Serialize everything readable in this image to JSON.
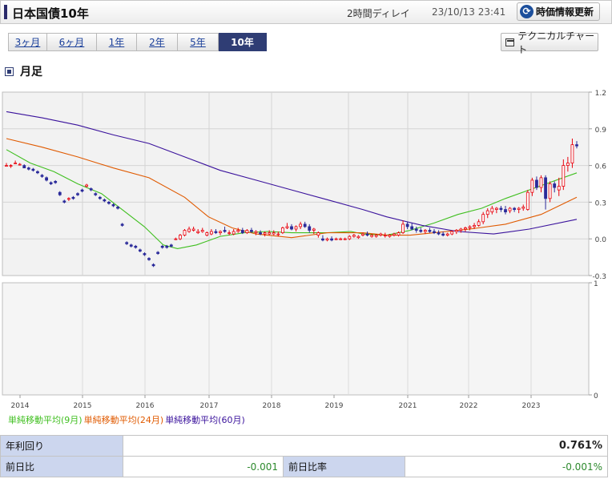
{
  "header": {
    "title": "日本国債10年",
    "delay": "2時間ディレイ",
    "timestamp": "23/10/13 23:41",
    "refresh_label": "時価情報更新",
    "refresh_icon": "refresh-icon"
  },
  "tabs": [
    {
      "label": "3ヶ月",
      "active": false
    },
    {
      "label": "6ヶ月",
      "active": false
    },
    {
      "label": "1年",
      "active": false
    },
    {
      "label": "2年",
      "active": false
    },
    {
      "label": "5年",
      "active": false
    },
    {
      "label": "10年",
      "active": true
    }
  ],
  "technical_button": "テクニカルチャート",
  "section_title": "月足",
  "legend": [
    {
      "label": "単純移動平均(9月)",
      "color": "#3fbf1f"
    },
    {
      "label": "単純移動平均(24月)",
      "color": "#e05a00"
    },
    {
      "label": "単純移動平均(60月)",
      "color": "#3a129c"
    }
  ],
  "quote": {
    "yield_label": "年利回り",
    "yield_value": "0.761%",
    "change_label": "前日比",
    "change_value": "-0.001",
    "change_rate_label": "前日比率",
    "change_rate_value": "-0.001%"
  },
  "chart_data": {
    "type": "candlestick",
    "x_axis": {
      "label": "",
      "ticks": [
        "2014",
        "2015",
        "2016",
        "2017",
        "2018",
        "2019",
        "2021",
        "2022",
        "2023"
      ]
    },
    "price_axis": {
      "ylim": [
        -0.3,
        1.2
      ],
      "ticks": [
        "1.2",
        "0.9",
        "0.6",
        "0.3",
        "0.0",
        "-0.3"
      ]
    },
    "volume_axis": {
      "ticks": [
        "1",
        "0"
      ]
    },
    "colors": {
      "up": "#e8000b",
      "down": "#2a2a9a"
    },
    "candles_approx": [
      [
        0.6,
        0.62,
        0.59,
        0.6
      ],
      [
        0.6,
        0.61,
        0.58,
        0.6
      ],
      [
        0.62,
        0.64,
        0.61,
        0.62
      ],
      [
        0.61,
        0.62,
        0.6,
        0.61
      ],
      [
        0.6,
        0.61,
        0.58,
        0.58
      ],
      [
        0.58,
        0.59,
        0.56,
        0.57
      ],
      [
        0.57,
        0.58,
        0.55,
        0.56
      ],
      [
        0.55,
        0.56,
        0.53,
        0.54
      ],
      [
        0.52,
        0.53,
        0.5,
        0.51
      ],
      [
        0.5,
        0.51,
        0.47,
        0.48
      ],
      [
        0.46,
        0.47,
        0.44,
        0.45
      ],
      [
        0.47,
        0.48,
        0.45,
        0.46
      ],
      [
        0.38,
        0.39,
        0.35,
        0.36
      ],
      [
        0.31,
        0.32,
        0.29,
        0.3
      ],
      [
        0.33,
        0.34,
        0.31,
        0.33
      ],
      [
        0.34,
        0.35,
        0.32,
        0.33
      ],
      [
        0.37,
        0.38,
        0.35,
        0.36
      ],
      [
        0.4,
        0.41,
        0.38,
        0.39
      ],
      [
        0.43,
        0.45,
        0.42,
        0.44
      ],
      [
        0.41,
        0.42,
        0.39,
        0.4
      ],
      [
        0.37,
        0.38,
        0.35,
        0.36
      ],
      [
        0.34,
        0.35,
        0.32,
        0.33
      ],
      [
        0.32,
        0.33,
        0.3,
        0.31
      ],
      [
        0.3,
        0.31,
        0.28,
        0.29
      ],
      [
        0.28,
        0.29,
        0.26,
        0.27
      ],
      [
        0.26,
        0.27,
        0.24,
        0.25
      ],
      [
        0.12,
        0.13,
        0.1,
        0.11
      ],
      [
        -0.03,
        -0.02,
        -0.05,
        -0.04
      ],
      [
        -0.05,
        -0.04,
        -0.07,
        -0.06
      ],
      [
        -0.06,
        -0.05,
        -0.08,
        -0.07
      ],
      [
        -0.09,
        -0.08,
        -0.11,
        -0.1
      ],
      [
        -0.12,
        -0.11,
        -0.14,
        -0.13
      ],
      [
        -0.16,
        -0.15,
        -0.18,
        -0.17
      ],
      [
        -0.21,
        -0.2,
        -0.23,
        -0.22
      ],
      [
        -0.11,
        -0.1,
        -0.13,
        -0.12
      ],
      [
        -0.06,
        -0.05,
        -0.08,
        -0.07
      ],
      [
        -0.06,
        -0.05,
        -0.08,
        -0.07
      ],
      [
        -0.05,
        -0.04,
        -0.07,
        -0.06
      ],
      [
        0.0,
        0.01,
        -0.01,
        0.0
      ],
      [
        0.0,
        0.04,
        -0.01,
        0.03
      ],
      [
        0.03,
        0.08,
        0.02,
        0.07
      ],
      [
        0.06,
        0.1,
        0.05,
        0.08
      ],
      [
        0.07,
        0.1,
        0.06,
        0.08
      ],
      [
        0.05,
        0.08,
        0.04,
        0.06
      ],
      [
        0.06,
        0.09,
        0.05,
        0.07
      ],
      [
        0.03,
        0.06,
        0.02,
        0.05
      ],
      [
        0.04,
        0.08,
        0.03,
        0.06
      ],
      [
        0.06,
        0.08,
        0.04,
        0.05
      ],
      [
        0.05,
        0.07,
        0.03,
        0.06
      ],
      [
        0.07,
        0.1,
        0.05,
        0.06
      ],
      [
        0.05,
        0.07,
        0.03,
        0.05
      ],
      [
        0.04,
        0.08,
        0.03,
        0.06
      ],
      [
        0.06,
        0.09,
        0.05,
        0.07
      ],
      [
        0.07,
        0.09,
        0.04,
        0.05
      ],
      [
        0.05,
        0.08,
        0.04,
        0.07
      ],
      [
        0.07,
        0.09,
        0.05,
        0.06
      ],
      [
        0.05,
        0.07,
        0.03,
        0.06
      ],
      [
        0.05,
        0.07,
        0.03,
        0.04
      ],
      [
        0.04,
        0.06,
        0.02,
        0.05
      ],
      [
        0.04,
        0.07,
        0.03,
        0.05
      ],
      [
        0.04,
        0.07,
        0.03,
        0.05
      ],
      [
        0.04,
        0.06,
        0.02,
        0.04
      ],
      [
        0.05,
        0.1,
        0.04,
        0.09
      ],
      [
        0.09,
        0.13,
        0.08,
        0.1
      ],
      [
        0.1,
        0.12,
        0.07,
        0.08
      ],
      [
        0.08,
        0.11,
        0.06,
        0.1
      ],
      [
        0.1,
        0.14,
        0.08,
        0.12
      ],
      [
        0.12,
        0.14,
        0.09,
        0.1
      ],
      [
        0.1,
        0.12,
        0.05,
        0.07
      ],
      [
        0.07,
        0.09,
        0.04,
        0.08
      ],
      [
        0.03,
        0.06,
        0.01,
        0.05
      ],
      [
        0.0,
        0.03,
        -0.02,
        -0.01
      ],
      [
        -0.01,
        0.01,
        -0.02,
        0.0
      ],
      [
        0.0,
        0.02,
        -0.02,
        -0.01
      ],
      [
        0.0,
        0.01,
        -0.01,
        0.0
      ],
      [
        0.0,
        0.01,
        -0.01,
        0.0
      ],
      [
        0.0,
        0.01,
        -0.01,
        0.0
      ],
      [
        0.0,
        0.03,
        -0.01,
        0.02
      ],
      [
        0.02,
        0.04,
        0.01,
        0.03
      ],
      [
        0.01,
        0.03,
        0.0,
        0.02
      ],
      [
        0.03,
        0.05,
        0.02,
        0.04
      ],
      [
        0.04,
        0.06,
        0.02,
        0.03
      ],
      [
        0.02,
        0.04,
        0.01,
        0.03
      ],
      [
        0.02,
        0.04,
        0.01,
        0.03
      ],
      [
        0.03,
        0.05,
        0.02,
        0.04
      ],
      [
        0.03,
        0.05,
        0.01,
        0.03
      ],
      [
        0.02,
        0.04,
        0.01,
        0.03
      ],
      [
        0.03,
        0.05,
        0.02,
        0.04
      ],
      [
        0.03,
        0.06,
        0.02,
        0.05
      ],
      [
        0.05,
        0.15,
        0.04,
        0.12
      ],
      [
        0.12,
        0.14,
        0.08,
        0.1
      ],
      [
        0.1,
        0.13,
        0.07,
        0.08
      ],
      [
        0.08,
        0.1,
        0.05,
        0.07
      ],
      [
        0.07,
        0.09,
        0.05,
        0.06
      ],
      [
        0.06,
        0.08,
        0.04,
        0.07
      ],
      [
        0.07,
        0.09,
        0.05,
        0.06
      ],
      [
        0.06,
        0.08,
        0.04,
        0.05
      ],
      [
        0.05,
        0.07,
        0.03,
        0.04
      ],
      [
        0.04,
        0.06,
        0.02,
        0.03
      ],
      [
        0.03,
        0.05,
        0.02,
        0.04
      ],
      [
        0.04,
        0.07,
        0.03,
        0.06
      ],
      [
        0.06,
        0.08,
        0.04,
        0.07
      ],
      [
        0.07,
        0.09,
        0.05,
        0.08
      ],
      [
        0.08,
        0.1,
        0.06,
        0.09
      ],
      [
        0.09,
        0.11,
        0.07,
        0.1
      ],
      [
        0.1,
        0.13,
        0.08,
        0.11
      ],
      [
        0.11,
        0.16,
        0.1,
        0.14
      ],
      [
        0.14,
        0.22,
        0.12,
        0.2
      ],
      [
        0.2,
        0.25,
        0.17,
        0.23
      ],
      [
        0.22,
        0.27,
        0.2,
        0.25
      ],
      [
        0.24,
        0.26,
        0.21,
        0.25
      ],
      [
        0.25,
        0.27,
        0.22,
        0.24
      ],
      [
        0.24,
        0.27,
        0.2,
        0.22
      ],
      [
        0.23,
        0.26,
        0.21,
        0.25
      ],
      [
        0.25,
        0.26,
        0.22,
        0.24
      ],
      [
        0.24,
        0.26,
        0.21,
        0.25
      ],
      [
        0.25,
        0.28,
        0.23,
        0.26
      ],
      [
        0.24,
        0.4,
        0.23,
        0.38
      ],
      [
        0.38,
        0.5,
        0.35,
        0.48
      ],
      [
        0.48,
        0.51,
        0.4,
        0.42
      ],
      [
        0.42,
        0.52,
        0.38,
        0.5
      ],
      [
        0.5,
        0.52,
        0.24,
        0.33
      ],
      [
        0.33,
        0.47,
        0.3,
        0.45
      ],
      [
        0.45,
        0.47,
        0.38,
        0.42
      ],
      [
        0.4,
        0.5,
        0.35,
        0.43
      ],
      [
        0.43,
        0.65,
        0.4,
        0.6
      ],
      [
        0.6,
        0.67,
        0.55,
        0.62
      ],
      [
        0.62,
        0.82,
        0.58,
        0.77
      ],
      [
        0.77,
        0.8,
        0.74,
        0.76
      ]
    ],
    "sma": {
      "ma9": [
        [
          0,
          0.73
        ],
        [
          10,
          0.62
        ],
        [
          20,
          0.55
        ],
        [
          30,
          0.45
        ],
        [
          40,
          0.37
        ],
        [
          50,
          0.22
        ],
        [
          58,
          0.1
        ],
        [
          66,
          -0.05
        ],
        [
          72,
          -0.08
        ],
        [
          80,
          -0.05
        ],
        [
          90,
          0.02
        ],
        [
          100,
          0.05
        ],
        [
          110,
          0.06
        ],
        [
          120,
          0.05
        ],
        [
          135,
          0.05
        ],
        [
          145,
          0.06
        ],
        [
          150,
          0.04
        ],
        [
          160,
          0.03
        ],
        [
          170,
          0.07
        ],
        [
          180,
          0.13
        ],
        [
          190,
          0.2
        ],
        [
          200,
          0.25
        ],
        [
          210,
          0.33
        ],
        [
          220,
          0.4
        ],
        [
          230,
          0.47
        ],
        [
          240,
          0.54
        ]
      ],
      "ma24": [
        [
          0,
          0.82
        ],
        [
          15,
          0.75
        ],
        [
          30,
          0.67
        ],
        [
          45,
          0.58
        ],
        [
          60,
          0.5
        ],
        [
          75,
          0.34
        ],
        [
          85,
          0.18
        ],
        [
          95,
          0.09
        ],
        [
          105,
          0.04
        ],
        [
          120,
          0.01
        ],
        [
          135,
          0.05
        ],
        [
          150,
          0.05
        ],
        [
          160,
          0.03
        ],
        [
          170,
          0.03
        ],
        [
          180,
          0.05
        ],
        [
          195,
          0.08
        ],
        [
          210,
          0.12
        ],
        [
          225,
          0.2
        ],
        [
          240,
          0.34
        ]
      ],
      "ma60": [
        [
          0,
          1.04
        ],
        [
          15,
          0.99
        ],
        [
          30,
          0.93
        ],
        [
          45,
          0.85
        ],
        [
          60,
          0.78
        ],
        [
          75,
          0.67
        ],
        [
          90,
          0.56
        ],
        [
          105,
          0.48
        ],
        [
          120,
          0.4
        ],
        [
          135,
          0.32
        ],
        [
          150,
          0.24
        ],
        [
          160,
          0.18
        ],
        [
          175,
          0.11
        ],
        [
          190,
          0.06
        ],
        [
          205,
          0.04
        ],
        [
          220,
          0.08
        ],
        [
          240,
          0.16
        ]
      ]
    }
  }
}
